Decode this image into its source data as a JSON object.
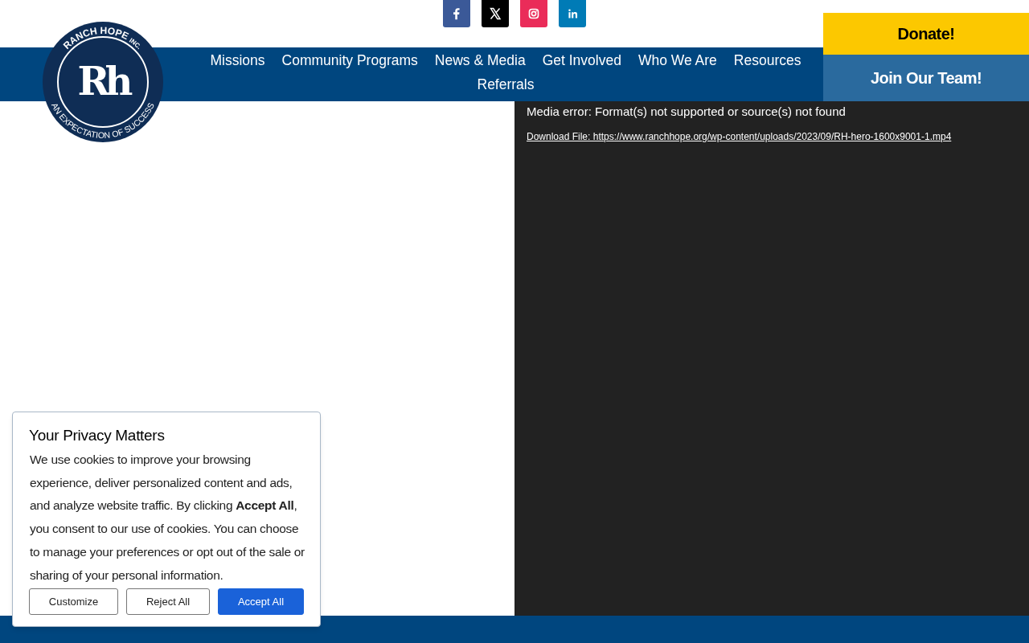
{
  "social_links": [
    {
      "kind": "facebook",
      "color": "#3b5998"
    },
    {
      "kind": "x",
      "color": "#000000"
    },
    {
      "kind": "instagram",
      "color": "#ea2c59"
    },
    {
      "kind": "linkedin",
      "color": "#007bb6"
    }
  ],
  "logo": {
    "top_text": "RANCH HOPE",
    "suffix": "INC.",
    "monogram": "Rh",
    "motto": "AN EXPECTATION OF SUCCESS"
  },
  "nav": {
    "items": [
      "Missions",
      "Community Programs",
      "News & Media",
      "Get Involved",
      "Who We Are",
      "Resources",
      "Referrals"
    ]
  },
  "actions": [
    {
      "kind": "donate",
      "label": "Donate!"
    },
    {
      "kind": "join",
      "label": "Join Our Team!"
    }
  ],
  "video": {
    "error": "Media error: Format(s) not supported or source(s) not found",
    "download_link": "Download File: https://www.ranchhope.org/wp-content/uploads/2023/09/RH-hero-1600x9001-1.mp4"
  },
  "cookie_banner": {
    "title": "Your Privacy Matters",
    "text": "We use cookies to improve your browsing experience, deliver personalized content and ads, and analyze website traffic.  By clicking **Accept All**, you consent to our use of cookies. You can choose to manage your preferences or opt out of the sale or sharing of your personal information.",
    "buttons": [
      {
        "label": "Customize",
        "primary": false
      },
      {
        "label": "Reject All",
        "primary": false
      },
      {
        "label": "Accept All",
        "primary": true
      }
    ]
  }
}
